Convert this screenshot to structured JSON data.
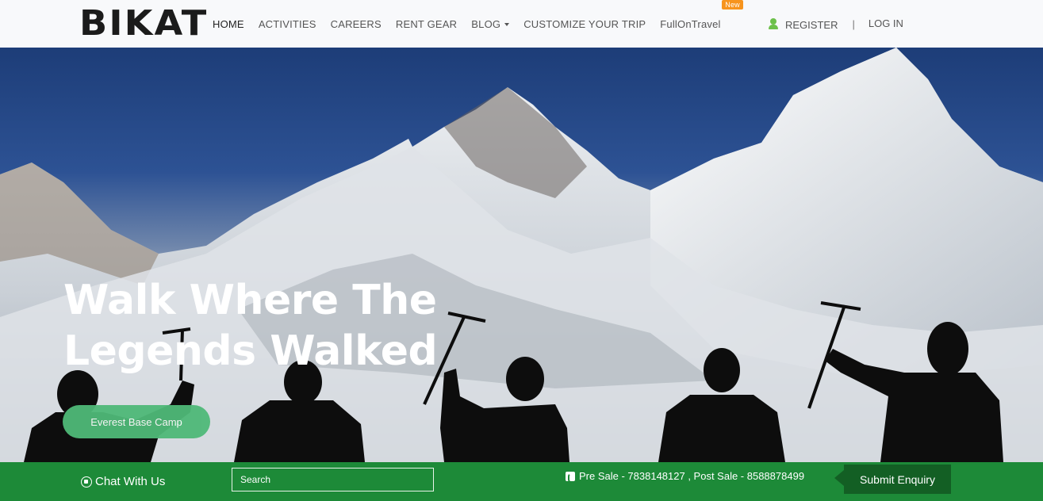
{
  "brand": {
    "logo_text": "BIKAT"
  },
  "nav": {
    "items": [
      {
        "label": "HOME"
      },
      {
        "label": "ACTIVITIES"
      },
      {
        "label": "CAREERS"
      },
      {
        "label": "RENT GEAR"
      },
      {
        "label": "BLOG"
      },
      {
        "label": "CUSTOMIZE YOUR TRIP"
      },
      {
        "label": "FullOnTravel",
        "badge": "New"
      }
    ],
    "register_label": "REGISTER",
    "separator": "|",
    "login_label": "LOG IN"
  },
  "hero": {
    "title_line1": "Walk Where The",
    "title_line2": "Legends Walked",
    "cta_label": "Everest Base Camp"
  },
  "bottom_bar": {
    "chat_label": "Chat With Us",
    "search_placeholder": "Search",
    "phones_text": "Pre Sale - 7838148127 , Post Sale - 8588878499",
    "submit_label": "Submit Enquiry"
  },
  "colors": {
    "accent_green": "#1d8a38",
    "dark_green": "#135f24",
    "badge_orange": "#f7941d",
    "pill_green": "#4fb978",
    "user_icon_green": "#6cc04a"
  },
  "icons": [
    "user-icon",
    "whatsapp-icon",
    "phone-icon",
    "dropdown-caret-icon"
  ]
}
